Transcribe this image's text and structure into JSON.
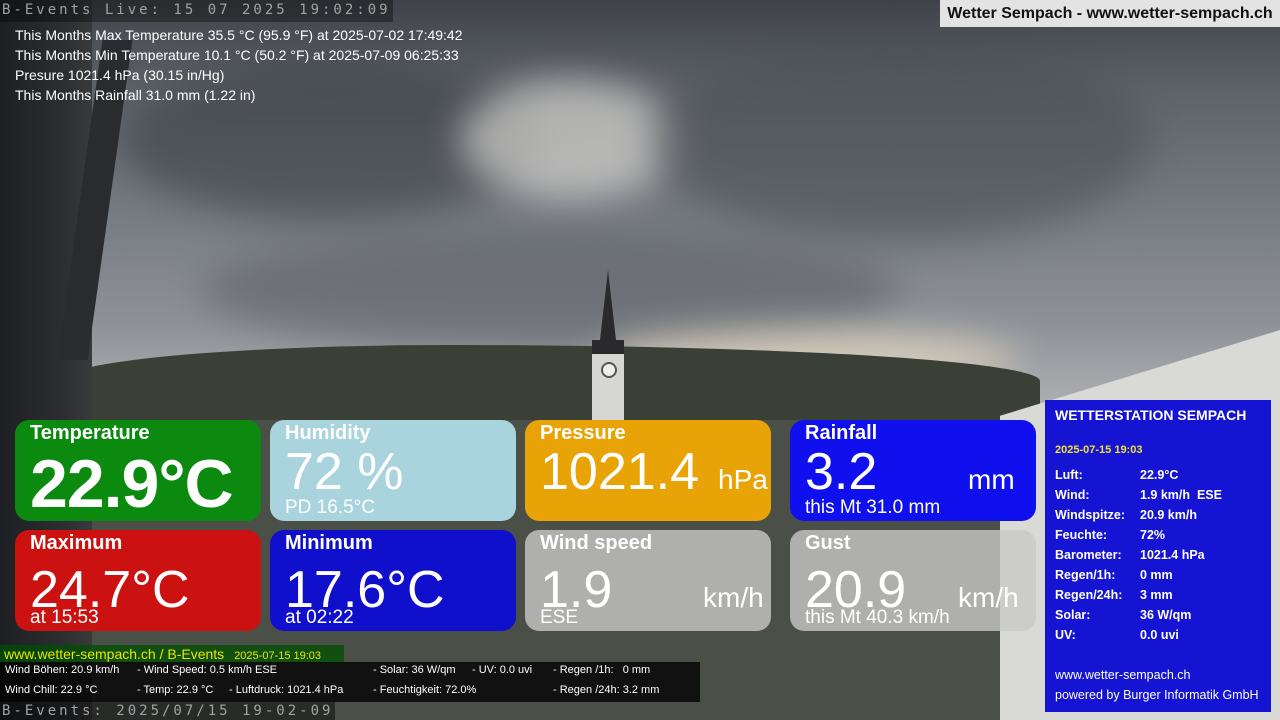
{
  "overlay": {
    "top_label": "B-Events Live: 15 07 2025 19:02:09",
    "bottom_label": "B-Events: 2025/07/15 19-02-09",
    "site_banner": "Wetter Sempach - www.wetter-sempach.ch"
  },
  "info_lines": [
    "This Months Max Temperature 35.5 °C (95.9 °F) at 2025-07-02 17:49:42",
    "This Months Min Temperature 10.1 °C (50.2 °F) at 2025-07-09 06:25:33",
    "Presure 1021.4 hPa (30.15 in/Hg)",
    "This Months Rainfall 31.0 mm (1.22 in)"
  ],
  "tiles": {
    "temperature": {
      "title": "Temperature",
      "value": "22.9°C",
      "color": "#0c8a10"
    },
    "humidity": {
      "title": "Humidity",
      "value": "72 %",
      "sub": "PD 16.5°C",
      "color": "#a9d3dd"
    },
    "pressure": {
      "title": "Pressure",
      "value": "1021.4",
      "unit": "hPa",
      "color": "#e8a307"
    },
    "rainfall": {
      "title": "Rainfall",
      "value": "3.2",
      "unit": "mm",
      "sub": "this Mt 31.0 mm",
      "color": "#1010ee"
    },
    "maximum": {
      "title": "Maximum",
      "value": "24.7°C",
      "sub": "at 15:53",
      "color": "#cc1111"
    },
    "minimum": {
      "title": "Minimum",
      "value": "17.6°C",
      "sub": "at 02:22",
      "color": "#1010cc"
    },
    "windspeed": {
      "title": "Wind speed",
      "value": "1.9",
      "unit": "km/h",
      "sub": "ESE"
    },
    "gust": {
      "title": "Gust",
      "value": "20.9",
      "unit": "km/h",
      "sub": "this Mt 40.3 km/h"
    }
  },
  "station": {
    "heading": "WETTERSTATION SEMPACH",
    "date": "2025-07-15 19:03",
    "rows": [
      {
        "k": "Luft:",
        "v": "22.9°C"
      },
      {
        "k": "Wind:",
        "v": "1.9 km/h  ESE"
      },
      {
        "k": "Windspitze:",
        "v": "20.9 km/h"
      },
      {
        "k": "Feuchte:",
        "v": "72%"
      },
      {
        "k": "Barometer:",
        "v": "1021.4 hPa"
      },
      {
        "k": "Regen/1h:",
        "v": "0 mm"
      },
      {
        "k": "Regen/24h:",
        "v": "3 mm"
      },
      {
        "k": "Solar:",
        "v": "36 W/qm"
      },
      {
        "k": "UV:",
        "v": "0.0 uvi"
      }
    ],
    "footer_site": "www.wetter-sempach.ch",
    "footer_powered": "powered by Burger Informatik GmbH"
  },
  "ticker": {
    "site": "www.wetter-sempach.ch / B-Events",
    "date": "2025-07-15 19:03",
    "line1": {
      "a": "Wind Böhen: 20.9 km/h",
      "b": "- Wind Speed: 0.5 km/h ESE",
      "c": "- Solar: 36 W/qm",
      "d": "- UV: 0.0 uvi",
      "e": "- Regen /1h:   0 mm"
    },
    "line2": {
      "a": "Wind Chill: 22.9 °C",
      "b": "- Temp: 22.9 °C",
      "b2": "- Luftdruck: 1021.4 hPa",
      "c": "- Feuchtigkeit: 72.0%",
      "e": "- Regen /24h: 3.2 mm"
    }
  }
}
